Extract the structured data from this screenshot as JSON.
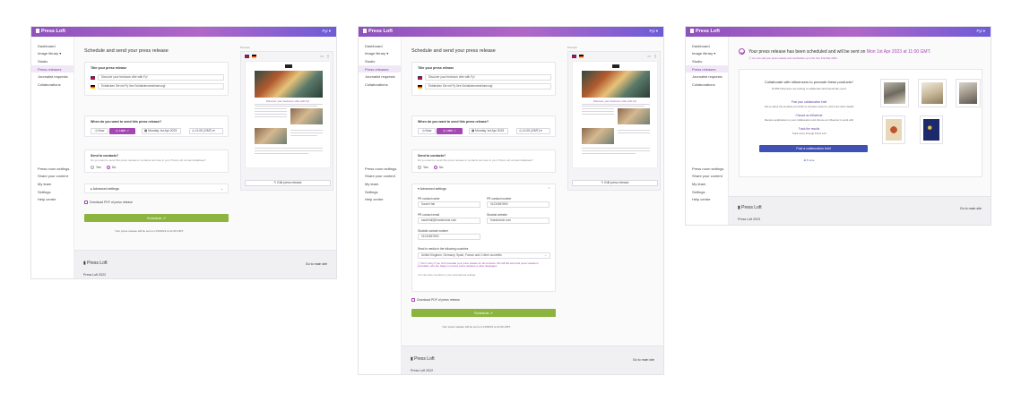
{
  "app": {
    "name": "Press Loft",
    "user": "Fyi"
  },
  "sidebar": {
    "items": [
      {
        "label": "Dashboard"
      },
      {
        "label": "Image library"
      },
      {
        "label": "Studio"
      },
      {
        "label": "Press releases"
      },
      {
        "label": "Journalist requests"
      },
      {
        "label": "Collaborations"
      }
    ],
    "bottom": [
      {
        "label": "Press room settings"
      },
      {
        "label": "Share your content"
      },
      {
        "label": "My team"
      },
      {
        "label": "Settings"
      },
      {
        "label": "Help centre"
      }
    ]
  },
  "schedule": {
    "heading": "Schedule and send your press release",
    "preview_label": "Preview",
    "title_section": "Title your press release",
    "title_en": "Discover your bedroom vibe with Fy!",
    "title_de": "Entdecken Sie mit Fy Ihre Schlafzimmerstimmung!",
    "when_section": "When do you want to send this press release?",
    "now_label": "Now",
    "later_label": "Later",
    "date_value": "Monday 1st Apr 2023",
    "time_value": "11:00 (GMT)",
    "contacts_section": "Send to contacts?",
    "contacts_desc": "Do you want to send this press release to contacts we have in your Press Loft contact database?",
    "yes_label": "Yes",
    "no_label": "No",
    "advanced_label": "Advanced settings",
    "download_pdf": "Download PDF of press release",
    "schedule_button": "Schedule",
    "scheduled_note": "Your press release will be sent on 01/04/23 at 11:00 GMT.",
    "edit_button": "Edit press release",
    "preview_title": "Discover your bedroom vibe with Fy!"
  },
  "advanced": {
    "pr_name_label": "PR contact name",
    "pr_name_value": "Sarah Hall",
    "pr_number_label": "PR contact number",
    "pr_number_value": "01234567890",
    "pr_email_label": "PR contact email",
    "pr_email_value": "sarahhall@brandname.com",
    "stockist_web_label": "Stockist website",
    "stockist_web_value": "brandname.com",
    "stockist_num_label": "Stockist contact number",
    "stockist_num_value": "01234567890",
    "media_label": "Send to media in the following countries",
    "media_value": "United Kingdom, Germany, Spain, France and 2 other countries",
    "media_note": "Don't worry if you can't translate your press release for all countries. We will still send and press release to journalists, who are happy to receive press releases in other languages.",
    "media_more": "You can have countries in your international settings"
  },
  "success": {
    "headline": "Your press release has been scheduled and will be sent on",
    "headline_date": "Mon 1st Apr 2023 at 11:00 GMT.",
    "sub": "You can edit your press release and reschedule up to the Sun 31st Mar 2024.",
    "collab_title": "Collaborate with influencers to promote these products?",
    "collab_sub": "10,556 influencers are looking to collaborate with brands like yours!",
    "step1_title": "Post your collaboration brief",
    "step1_desc": "Tell us about the products you'd like to increase votes for, and a few other details",
    "step2_title": "Choose an influencer",
    "step2_desc": "Receive applications to your collaboration and choose an influencer to work with",
    "step3_title": "Track the results",
    "step3_desc": "Track every through Press Loft",
    "post_button": "Post a collaboration brief",
    "more_link": "5 more"
  },
  "footer": {
    "logo": "Press Loft",
    "main_site": "Go to main site",
    "copyright": "Press Loft 2022",
    "copyright_alt": "Press Loft 2023"
  }
}
